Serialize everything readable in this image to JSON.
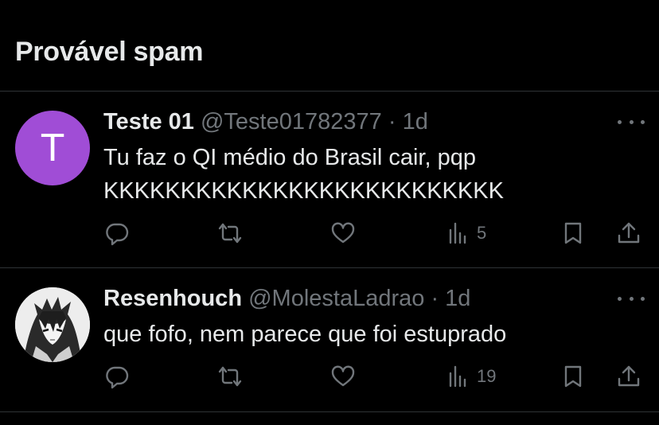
{
  "section": {
    "title": "Provável spam"
  },
  "tweets": [
    {
      "avatar_letter": "T",
      "name": "Teste 01",
      "handle": "@Teste01782377",
      "dot": "·",
      "time": "1d",
      "lines": [
        "Tu faz o QI médio do Brasil cair, pqp",
        "KKKKKKKKKKKKKKKKKKKKKKKKKK"
      ],
      "views": "5"
    },
    {
      "name": "Resenhouch",
      "handle": "@MolestaLadrao",
      "dot": "·",
      "time": "1d",
      "lines": [
        "que fofo, nem parece que foi estuprado"
      ],
      "views": "19"
    }
  ],
  "icons": {
    "reply": "reply-icon",
    "retweet": "retweet-icon",
    "like": "like-icon",
    "views": "views-icon",
    "bookmark": "bookmark-icon",
    "share": "share-icon",
    "more": "more-icon"
  },
  "colors": {
    "background": "#000000",
    "text": "#e7e9ea",
    "muted": "#71767b",
    "divider": "#2f3336",
    "avatar": "#a04dd6"
  }
}
